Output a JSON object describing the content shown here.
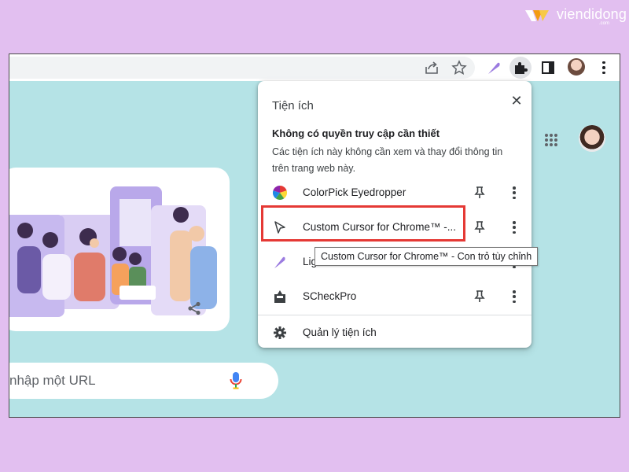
{
  "watermark": {
    "brand": "viendidong",
    "sub": ".com"
  },
  "browser": {
    "toolbar_icons": [
      "share-icon",
      "star-icon",
      "feather-extension-icon",
      "puzzle-extensions-icon",
      "side-panel-icon",
      "profile-avatar",
      "kebab-menu-icon"
    ]
  },
  "google": {
    "search_placeholder": "nhập một URL",
    "apps_icon": "apps-grid-icon",
    "doodle_share_icon": "share-icon"
  },
  "extensions_menu": {
    "title": "Tiện ích",
    "section_title": "Không có quyền truy cập cần thiết",
    "section_desc": "Các tiện ích này không cần xem và thay đổi thông tin trên trang web này.",
    "items": [
      {
        "name": "ColorPick Eyedropper",
        "icon": "colorpick-icon"
      },
      {
        "name": "Custom Cursor for Chrome™ -...",
        "icon": "cursor-arrow-icon"
      },
      {
        "name": "Lig",
        "icon": "feather-icon"
      },
      {
        "name": "SCheckPro",
        "icon": "scheckpro-icon"
      }
    ],
    "manage_label": "Quản lý tiện ích",
    "tooltip": "Custom Cursor for Chrome™ - Con trỏ tùy chỉnh",
    "highlight_color": "#e53935"
  }
}
